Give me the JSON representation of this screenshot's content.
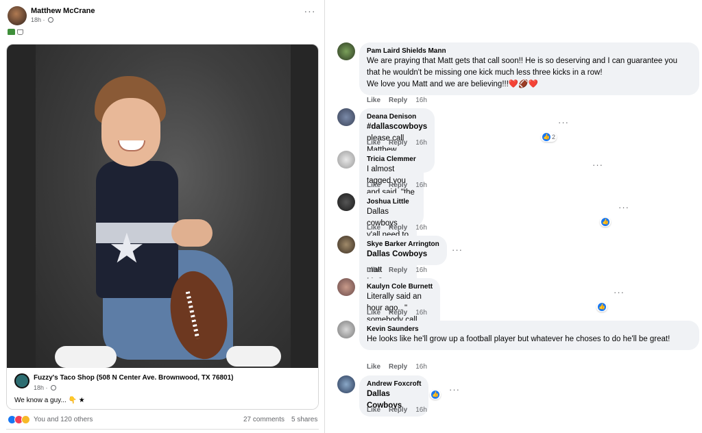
{
  "post": {
    "author": "Matthew McCrane",
    "time": "18h ·",
    "more": "···",
    "emoji_icons": [
      "car-icon",
      "cup-icon"
    ],
    "shared": {
      "page_name": "Fuzzy's Taco Shop (508 N Center Ave. Brownwood, TX 76801)",
      "time": "18h ·",
      "text": "We know a guy... 👇 ★"
    },
    "reactions_text": "You and 120 others",
    "comments_count": "27 comments",
    "shares_count": "5 shares"
  },
  "comments": [
    {
      "author": "Pam Laird Shields Mann",
      "text": "We are praying that Matt gets that call soon!! He is so deserving and I can guarantee you that he wouldn't be missing one kick much less three kicks in a row!\nWe love you Matt and we are believing!!!❤️🏈❤️",
      "like": "Like",
      "reply": "Reply",
      "time": "16h"
    },
    {
      "author": "Deana Denison",
      "hashtag": "#dallascowboys",
      "text": " please call Matthew McCrane",
      "like": "Like",
      "reply": "Reply",
      "time": "16h",
      "reaction_count": "2"
    },
    {
      "author": "Tricia Clemmer",
      "text": "I almost tagged you and said, \"the Cowboys need you!\"",
      "like": "Like",
      "reply": "Reply",
      "time": "16h"
    },
    {
      "author": "Joshua Little",
      "text": "Dallas cowboys y'all need to hire my best friend matt McCrane",
      "like": "Like",
      "reply": "Reply",
      "time": "16h"
    },
    {
      "author": "Skye Barker Arrington",
      "text": "Dallas Cowboys",
      "like": "Like",
      "reply": "Reply",
      "time": "16h"
    },
    {
      "author": "Kaulyn Cole Burnett",
      "text": "Literally said an hour ago.. \" somebody call Matt mccrane\" 😂",
      "like": "Like",
      "reply": "Reply",
      "time": "16h"
    },
    {
      "author": "Kevin Saunders",
      "text": "He looks like he'll grow up a football player but whatever he choses to do he'll be great!",
      "like": "Like",
      "reply": "Reply",
      "time": "16h"
    },
    {
      "author": "Andrew Foxcroft",
      "text": "Dallas Cowboys",
      "like": "Like",
      "reply": "Reply",
      "time": "16h"
    }
  ],
  "more": "···",
  "colors": {
    "like_blue": "#1877f2",
    "bubble": "#f0f2f5",
    "muted": "#65676b"
  }
}
